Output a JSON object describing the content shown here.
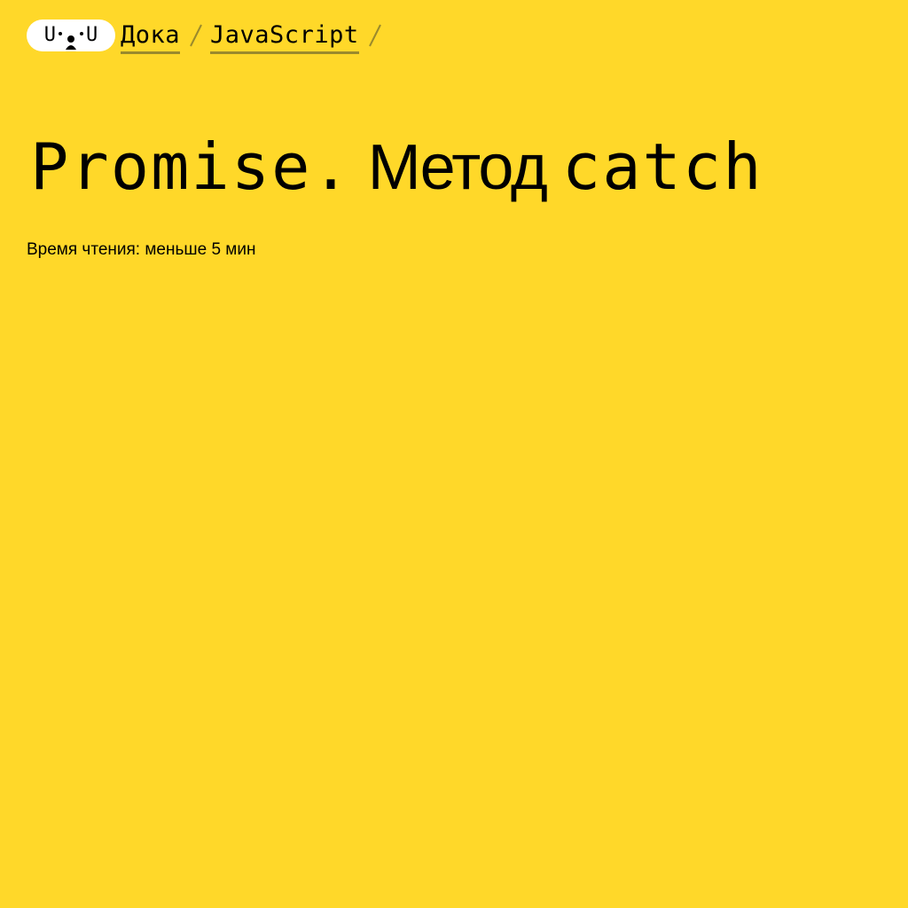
{
  "header": {
    "logo_left": "U",
    "logo_right": "U",
    "breadcrumbs": [
      {
        "label": "Дока"
      },
      {
        "label": "JavaScript"
      }
    ]
  },
  "article": {
    "title_part1": "Promise.",
    "title_part2": "Метод",
    "title_part3": "catch",
    "reading_time": "Время чтения: меньше 5 мин"
  },
  "colors": {
    "background": "#FFD829",
    "breadcrumb_underline": "#9B8A2C",
    "logo_bg": "#FFFFFF"
  }
}
